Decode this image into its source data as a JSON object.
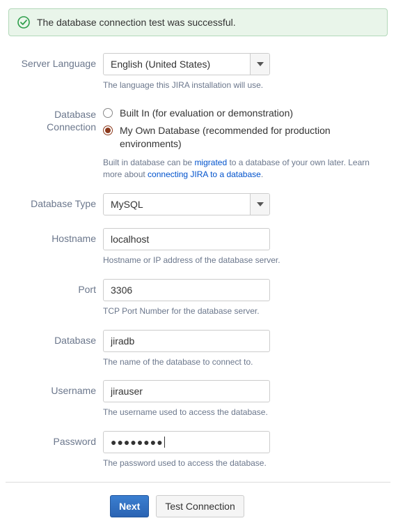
{
  "alert": {
    "message": "The database connection test was successful."
  },
  "server_language": {
    "label": "Server Language",
    "value": "English (United States)",
    "help": "The language this JIRA installation will use."
  },
  "db_connection": {
    "label_line1": "Database",
    "label_line2": "Connection",
    "option_builtin": "Built In (for evaluation or demonstration)",
    "option_own": "My Own Database (recommended for production environments)",
    "help_prefix": "Built in database can be ",
    "help_link1": "migrated",
    "help_mid": " to a database of your own later. Learn more about ",
    "help_link2": "connecting JIRA to a database",
    "help_suffix": "."
  },
  "db_type": {
    "label": "Database Type",
    "value": "MySQL"
  },
  "hostname": {
    "label": "Hostname",
    "value": "localhost",
    "help": "Hostname or IP address of the database server."
  },
  "port": {
    "label": "Port",
    "value": "3306",
    "help": "TCP Port Number for the database server."
  },
  "database": {
    "label": "Database",
    "value": "jiradb",
    "help": "The name of the database to connect to."
  },
  "username": {
    "label": "Username",
    "value": "jirauser",
    "help": "The username used to access the database."
  },
  "password": {
    "label": "Password",
    "masked": "●●●●●●●●",
    "help": "The password used to access the database."
  },
  "buttons": {
    "next": "Next",
    "test": "Test Connection"
  }
}
